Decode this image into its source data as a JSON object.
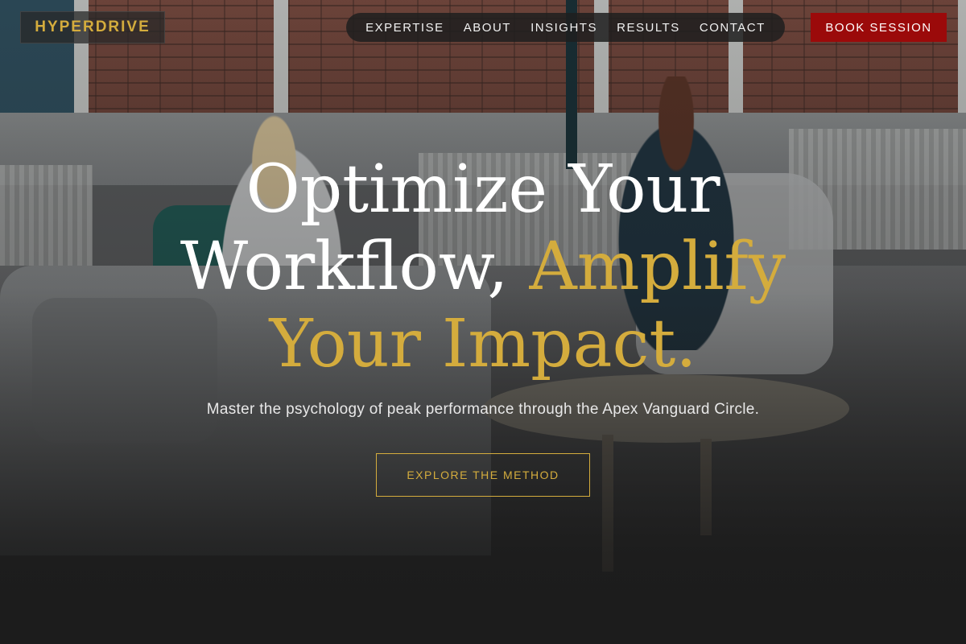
{
  "brand": {
    "logo": "HYPERDRIVE",
    "accent_color": "#d4ac3d",
    "cta_color": "#9b0a0a"
  },
  "nav": {
    "items": [
      "EXPERTISE",
      "ABOUT",
      "INSIGHTS",
      "RESULTS",
      "CONTACT"
    ]
  },
  "header": {
    "book_label": "BOOK SESSION"
  },
  "hero": {
    "headline_line1": "Optimize Your",
    "headline_line2_white": "Workflow,",
    "headline_line2_gold": "Amplify",
    "headline_line3_gold": "Your Impact.",
    "subtitle": "Master the psychology of peak performance through the Apex Vanguard Circle.",
    "cta_label": "EXPLORE THE METHOD",
    "background_image": "office-meeting-photo"
  }
}
